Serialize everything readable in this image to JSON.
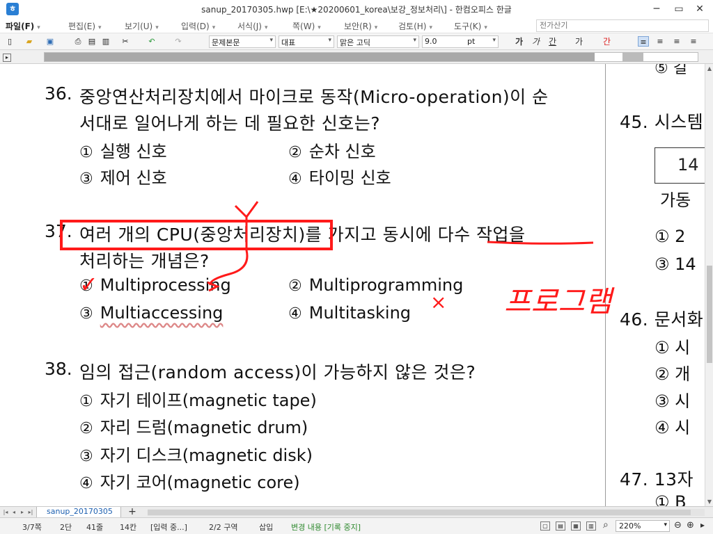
{
  "window": {
    "title": "sanup_20170305.hwp [E:\\★20200601_korea\\보강_정보처리\\] - 한컴오피스 한글",
    "app_icon": "hwp-app-icon",
    "minimize": "─",
    "restore": "▭",
    "close": "✕"
  },
  "menu": {
    "items": [
      "파일(F)",
      "편집(E)",
      "보기(U)",
      "입력(D)",
      "서식(J)",
      "쪽(W)",
      "보안(R)",
      "검토(H)",
      "도구(K)"
    ],
    "search_placeholder": "전가산기"
  },
  "toolbar": {
    "style": "문제본문",
    "font_lang": "대표",
    "font_name": "맑은 고딕",
    "font_size": "9.0",
    "size_unit": "pt",
    "char_buttons": [
      "가",
      "가",
      "간",
      "가",
      "간"
    ]
  },
  "document": {
    "q36": {
      "num": "36.",
      "line1": "중앙연산처리장치에서 마이크로 동작(Micro-operation)이 순",
      "line2": "서대로 일어나게 하는 데 필요한 신호는?",
      "options": [
        {
          "mark": "①",
          "text": "실행 신호"
        },
        {
          "mark": "②",
          "text": "순차 신호"
        },
        {
          "mark": "③",
          "text": "제어 신호"
        },
        {
          "mark": "④",
          "text": "타이밍 신호"
        }
      ]
    },
    "q37": {
      "num": "37.",
      "line1": "여러 개의 CPU(중앙처리장치)를 가지고 동시에 다수 작업을",
      "line2": "처리하는 개념은?",
      "options": [
        {
          "mark": "①",
          "text": "Multiprocessing"
        },
        {
          "mark": "②",
          "text": "Multiprogramming"
        },
        {
          "mark": "③",
          "text": "Multiaccessing"
        },
        {
          "mark": "④",
          "text": "Multitasking"
        }
      ]
    },
    "q38": {
      "num": "38.",
      "line1": "임의 접근(random access)이 가능하지 않은 것은?",
      "options": [
        {
          "mark": "①",
          "text": "자기 테이프(magnetic tape)"
        },
        {
          "mark": "②",
          "text": "자리 드럼(magnetic drum)"
        },
        {
          "mark": "③",
          "text": "자기 디스크(magnetic disk)"
        },
        {
          "mark": "④",
          "text": "자기 코어(magnetic core)"
        }
      ]
    },
    "right_col": {
      "prev_opt": "⑤ 길",
      "q45": "45. 시스템",
      "q45_box": "14",
      "q45_sub": "가동",
      "q45_opt1": "① 2",
      "q45_opt3": "③ 14",
      "q46": "46. 문서화",
      "q46_opts": [
        "① 시",
        "② 개",
        "③ 시",
        "④ 시"
      ],
      "q47": "47. 13자",
      "q47_opt1": "① B"
    }
  },
  "annotations": {
    "handwriting": "프로그램",
    "x_mark": "×",
    "check_mark": "✓",
    "ink_color": "#ff1a1a"
  },
  "tabs": {
    "doc_tab": "sanup_20170305",
    "add": "+"
  },
  "status": {
    "page": "3/7쪽",
    "column": "2단",
    "line": "41줄",
    "col": "14칸",
    "input_mode": "[입력 중...]",
    "section": "2/2 구역",
    "insert": "삽입",
    "track": "변경 내용 [기록 중지]",
    "zoom": "220%"
  }
}
